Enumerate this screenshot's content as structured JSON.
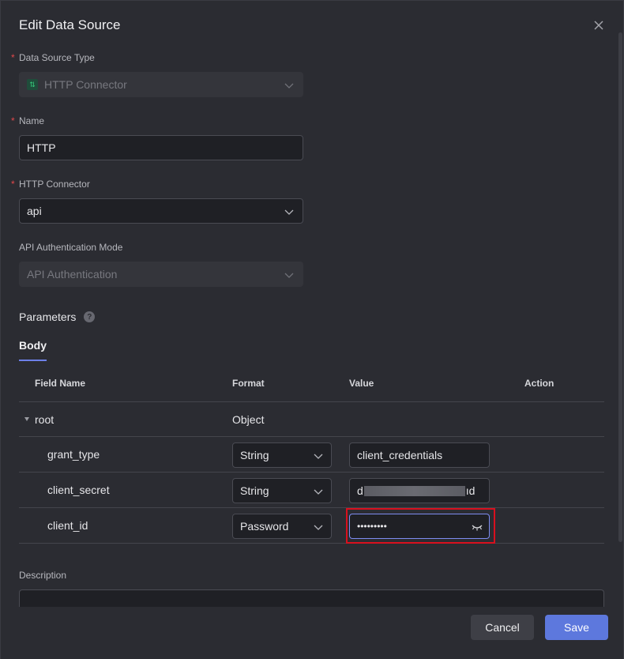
{
  "dialog": {
    "title": "Edit Data Source"
  },
  "form": {
    "required_mark": "*",
    "data_source_type": {
      "label": "Data Source Type",
      "value": "HTTP Connector",
      "icon": "connector-icon"
    },
    "name": {
      "label": "Name",
      "value": "HTTP"
    },
    "http_connector": {
      "label": "HTTP Connector",
      "value": "api"
    },
    "auth_mode": {
      "label": "API Authentication Mode",
      "value": "API Authentication"
    }
  },
  "parameters": {
    "title": "Parameters",
    "help": "?",
    "tab": "Body",
    "columns": {
      "field_name": "Field Name",
      "format": "Format",
      "value": "Value",
      "action": "Action"
    },
    "root": {
      "name": "root",
      "format": "Object"
    },
    "rows": [
      {
        "name": "grant_type",
        "format": "String",
        "value": "client_credentials"
      },
      {
        "name": "client_secret",
        "format": "String",
        "value_prefix": "d",
        "value_suffix": "ıd"
      },
      {
        "name": "client_id",
        "format": "Password",
        "value": "•••••••••"
      }
    ]
  },
  "description": {
    "label": "Description"
  },
  "footer": {
    "cancel": "Cancel",
    "save": "Save"
  },
  "colors": {
    "accent": "#5d78dd",
    "required": "#e0484b",
    "highlight": "#d8101e"
  }
}
